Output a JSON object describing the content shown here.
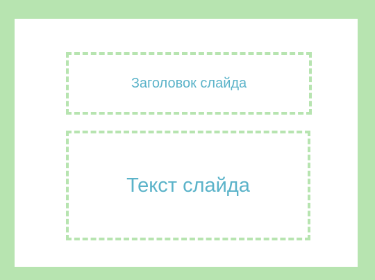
{
  "slide": {
    "title_placeholder": "Заголовок слайда",
    "body_placeholder": "Текст слайда"
  },
  "colors": {
    "frame": "#b7e4b0",
    "dash_border": "#b7e4b0",
    "placeholder_text": "#5bb3c9",
    "slide_background": "#ffffff"
  }
}
